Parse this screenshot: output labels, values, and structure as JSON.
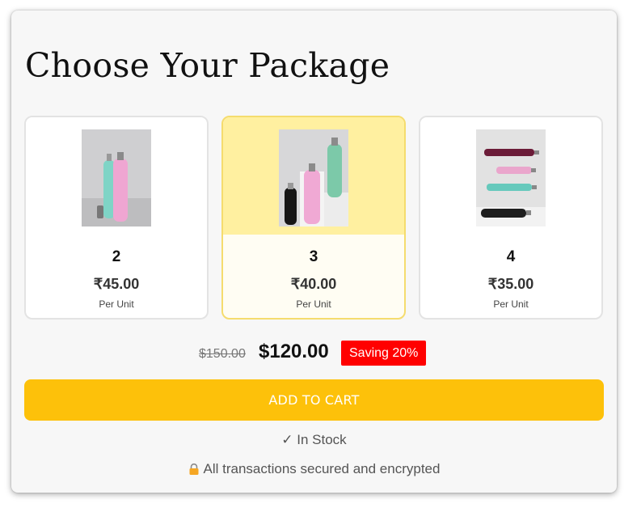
{
  "title": "Choose Your Package",
  "packages": [
    {
      "qty": "2",
      "price": "₹45.00",
      "unit": "Per Unit",
      "selected": false,
      "image": "two-bottles-image"
    },
    {
      "qty": "3",
      "price": "₹40.00",
      "unit": "Per Unit",
      "selected": true,
      "image": "three-bottles-image"
    },
    {
      "qty": "4",
      "price": "₹35.00",
      "unit": "Per Unit",
      "selected": false,
      "image": "four-bottles-image"
    }
  ],
  "pricing": {
    "old_price": "$150.00",
    "new_price": "$120.00",
    "saving": "Saving 20%"
  },
  "cart_button": "ADD TO CART",
  "stock": "✓ In Stock",
  "secure": "All transactions secured and encrypted",
  "colors": {
    "accent": "#fdc10a",
    "selected_bg": "#fff0a0",
    "saving_bg": "#ff0000"
  }
}
